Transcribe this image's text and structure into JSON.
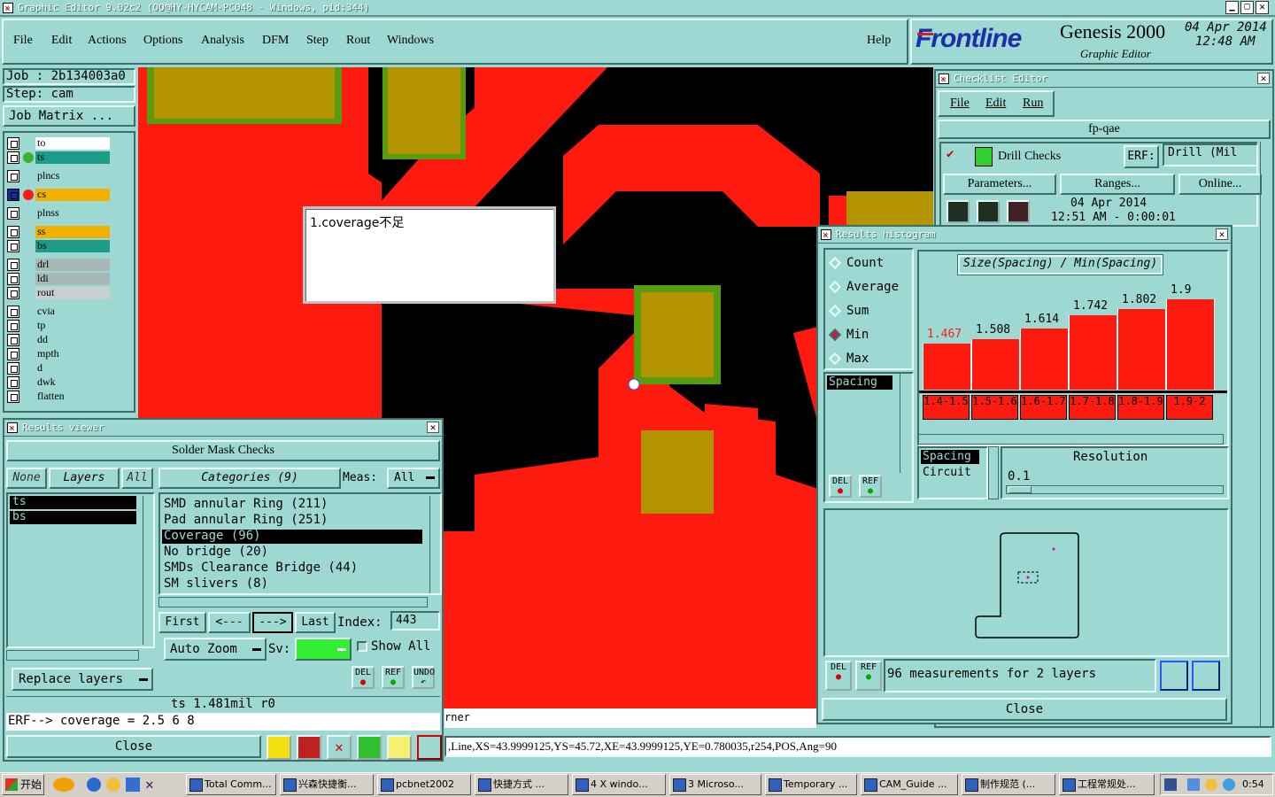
{
  "window_title": "Graphic Editor 9.02c2  (OO@HY-HYCAM-PC048 - Windows, pid:344)",
  "menu": [
    "File",
    "Edit",
    "Actions",
    "Options",
    "Analysis",
    "DFM",
    "Step",
    "Rout",
    "Windows"
  ],
  "help": "Help",
  "brand": {
    "logo": "Frontline",
    "product": "Genesis 2000",
    "subtitle": "Graphic Editor",
    "date": "04 Apr 2014",
    "time": "12:48 AM"
  },
  "job": {
    "job": "Job : 2b134003a0",
    "step": "Step: cam",
    "matrix_button": "Job Matrix ..."
  },
  "layers": [
    {
      "name": "to",
      "bg": "#ffffff"
    },
    {
      "name": "ts",
      "bg": "#1a9c88"
    },
    {
      "name": "plncs",
      "bg": "#9ed8d2"
    },
    {
      "name": "cs",
      "bg": "#f2b000"
    },
    {
      "name": "plnss",
      "bg": "#9ed8d2"
    },
    {
      "name": "ss",
      "bg": "#f2b000"
    },
    {
      "name": "bs",
      "bg": "#1a9c88"
    },
    {
      "name": "drl",
      "bg": "#a8b8b6"
    },
    {
      "name": "ldi",
      "bg": "#a8b8b6"
    },
    {
      "name": "rout",
      "bg": "#c8d0cf"
    },
    {
      "name": "cvia",
      "bg": "#9ed8d2"
    },
    {
      "name": "tp",
      "bg": "#9ed8d2"
    },
    {
      "name": "dd",
      "bg": "#9ed8d2"
    },
    {
      "name": "mpth",
      "bg": "#9ed8d2"
    },
    {
      "name": "d",
      "bg": "#9ed8d2"
    },
    {
      "name": "dwk",
      "bg": "#9ed8d2"
    },
    {
      "name": "flatten",
      "bg": "#9ed8d2"
    }
  ],
  "note_text": "1.coverage不足",
  "canvas_status": "rner",
  "coord_line": ",Line,XS=43.9999125,YS=45.72,XE=43.9999125,YE=0.780035,r254,POS,Ang=90",
  "results_viewer": {
    "title": "Results viewer",
    "header": "Solder Mask Checks",
    "none": "None",
    "layers": "Layers",
    "all": "All",
    "categories_label": "Categories (9)",
    "meas_label": "Meas:",
    "meas_value": "All",
    "layer_list": [
      "ts",
      "bs"
    ],
    "categories": [
      "SMD annular Ring (211)",
      "Pad annular Ring (251)",
      "Coverage (96)",
      "No bridge (20)",
      "SMDs Clearance Bridge (44)",
      "SM slivers (8)"
    ],
    "selected_category": 2,
    "first": "First",
    "prev": "<---",
    "next": "--->",
    "last": "Last",
    "index_label": "Index:",
    "index_value": "443",
    "auto_zoom": "Auto Zoom",
    "sv_label": "Sv:",
    "show_all": "Show All",
    "replace_layers": "Replace layers",
    "status1": "ts 1.481mil   r0",
    "status2": "ERF--> coverage = 2.5 6 8",
    "close": "Close"
  },
  "checklist": {
    "title": "Checklist Editor",
    "menu": [
      "File",
      "Edit",
      "Run"
    ],
    "name": "fp-qae",
    "check": "Drill Checks",
    "erf_label": "ERF:",
    "erf_value": "Drill (Mil",
    "params": "Parameters...",
    "ranges": "Ranges...",
    "online": "Online...",
    "date": "04 Apr 2014",
    "time": "12:51 AM - 0:00:01"
  },
  "histogram": {
    "title": "Results histogram",
    "modes": [
      "Count",
      "Average",
      "Sum",
      "Min",
      "Max"
    ],
    "selected_mode": 3,
    "heading": "Size(Spacing) / Min(Spacing)",
    "type_list": [
      "Spacing"
    ],
    "attr_list": [
      "Spacing",
      "Circuit"
    ],
    "resolution_label": "Resolution",
    "resolution_value": "0.1",
    "summary": "96 measurements for 2 layers",
    "close": "Close"
  },
  "chart_data": {
    "type": "bar",
    "categories": [
      "1.4-1.5",
      "1.5-1.6",
      "1.6-1.7",
      "1.7-1.8",
      "1.8-1.9",
      "1.9-2"
    ],
    "values": [
      1.467,
      1.508,
      1.614,
      1.742,
      1.802,
      1.9
    ],
    "title": "Size(Spacing) / Min(Spacing)",
    "ylim": [
      0,
      1.9
    ],
    "bar_color": "#ff1a10",
    "first_label_color": "#ff1a10"
  },
  "taskbar": {
    "start": "开始",
    "items": [
      "Total Comm...",
      "兴森快捷衡...",
      "pcbnet2002",
      "快捷方式 ...",
      "4 X windo...",
      "3 Microso...",
      "Temporary ...",
      "CAM_Guide ...",
      "制作规范 (...",
      "工程常规处..."
    ],
    "clock": "0:54"
  },
  "colors": {
    "panel": "#9ed8d2",
    "copper": "#ff1a10",
    "mask": "#000000",
    "pad": "#b39400",
    "pad_ring": "#5a9c10"
  }
}
